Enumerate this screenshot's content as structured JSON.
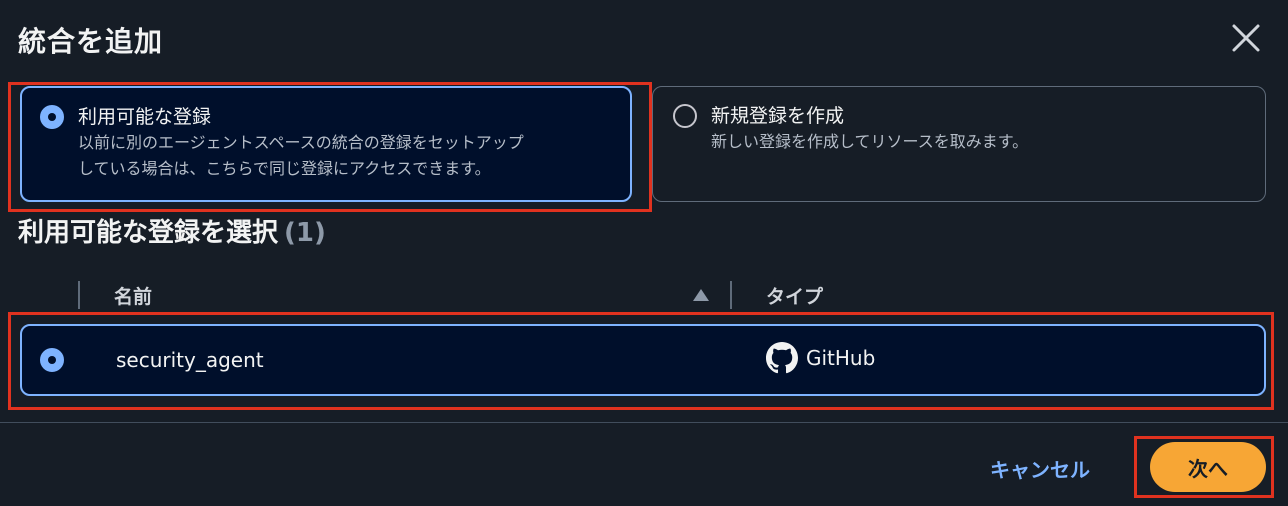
{
  "modal": {
    "title": "統合を追加",
    "close_icon": "close-icon"
  },
  "options": [
    {
      "label": "利用可能な登録",
      "description_line1": "以前に別のエージェントスペースの統合の登録をセットアップ",
      "description_line2": "している場合は、こちらで同じ登録にアクセスできます。",
      "selected": true
    },
    {
      "label": "新規登録を作成",
      "description_line1": "新しい登録を作成してリソースを取みます。",
      "selected": false
    }
  ],
  "section": {
    "title": "利用可能な登録を選択",
    "count": "(1)"
  },
  "table": {
    "columns": [
      "名前",
      "タイプ"
    ],
    "sort": "ascending",
    "rows": [
      {
        "name": "security_agent",
        "type": "GitHub",
        "type_icon": "github-icon",
        "selected": true
      }
    ]
  },
  "footer": {
    "cancel_label": "キャンセル",
    "next_label": "次へ"
  },
  "colors": {
    "background": "#161d26",
    "selected_fill": "#000f2b",
    "selected_border": "#7eb3ff",
    "link": "#7eb3ff",
    "primary_button": "#f7a635",
    "highlight_box": "#e0321f"
  }
}
